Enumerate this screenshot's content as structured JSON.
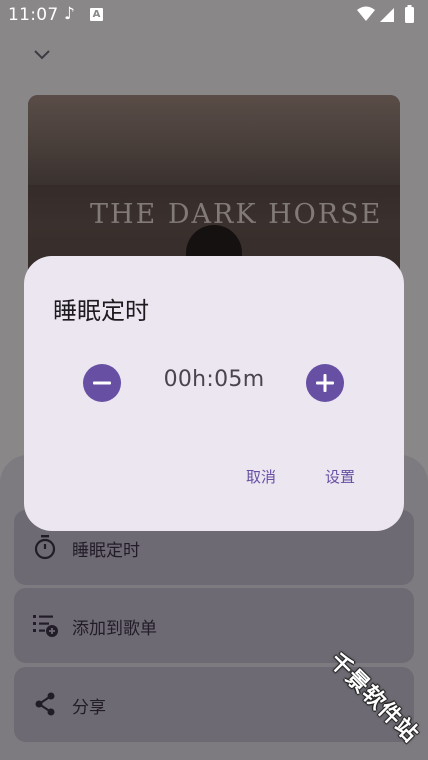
{
  "status_bar": {
    "time": "11:07"
  },
  "album": {
    "title_text": "THE DARK HORSE"
  },
  "sheet": {
    "items": [
      {
        "label": "睡眠定时",
        "icon": "timer-icon"
      },
      {
        "label": "添加到歌单",
        "icon": "playlist-add-icon"
      },
      {
        "label": "分享",
        "icon": "share-icon"
      }
    ]
  },
  "dialog": {
    "title": "睡眠定时",
    "timer_value": "00h:05m",
    "cancel_label": "取消",
    "confirm_label": "设置",
    "accent_color": "#6750a4"
  },
  "watermark": "千景软件站"
}
